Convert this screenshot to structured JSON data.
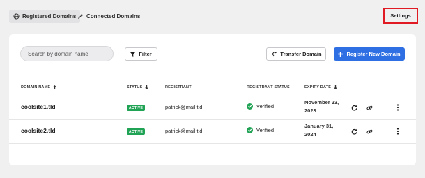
{
  "tabs": [
    {
      "label": "Registered Domains",
      "icon": "globe-icon",
      "active": true
    },
    {
      "label": "Connected Domains",
      "icon": "link-icon",
      "active": false
    }
  ],
  "settings_label": "Settings",
  "toolbar": {
    "search_placeholder": "Search by domain name",
    "filter_label": "Filter",
    "transfer_label": "Transfer Domain",
    "register_label": "Register New Domain"
  },
  "table": {
    "headers": {
      "domain": "DOMAIN NAME",
      "status": "STATUS",
      "registrant": "REGISTRANT",
      "registrant_status": "REGISTRANT STATUS",
      "expiry": "EXPIRY DATE"
    },
    "rows": [
      {
        "domain": "coolsite1.tld",
        "status": "ACTIVE",
        "registrant": "patrick@mail.tld",
        "registrant_status": "Verified",
        "expiry_line1": "November 23,",
        "expiry_line2": "2023"
      },
      {
        "domain": "coolsite2.tld",
        "status": "ACTIVE",
        "registrant": "patrick@mail.tld",
        "registrant_status": "Verified",
        "expiry_line1": "January 31,",
        "expiry_line2": "2024"
      }
    ]
  },
  "colors": {
    "accent": "#2f6fe4",
    "active_badge": "#21a356",
    "highlight": "#e01b24"
  }
}
